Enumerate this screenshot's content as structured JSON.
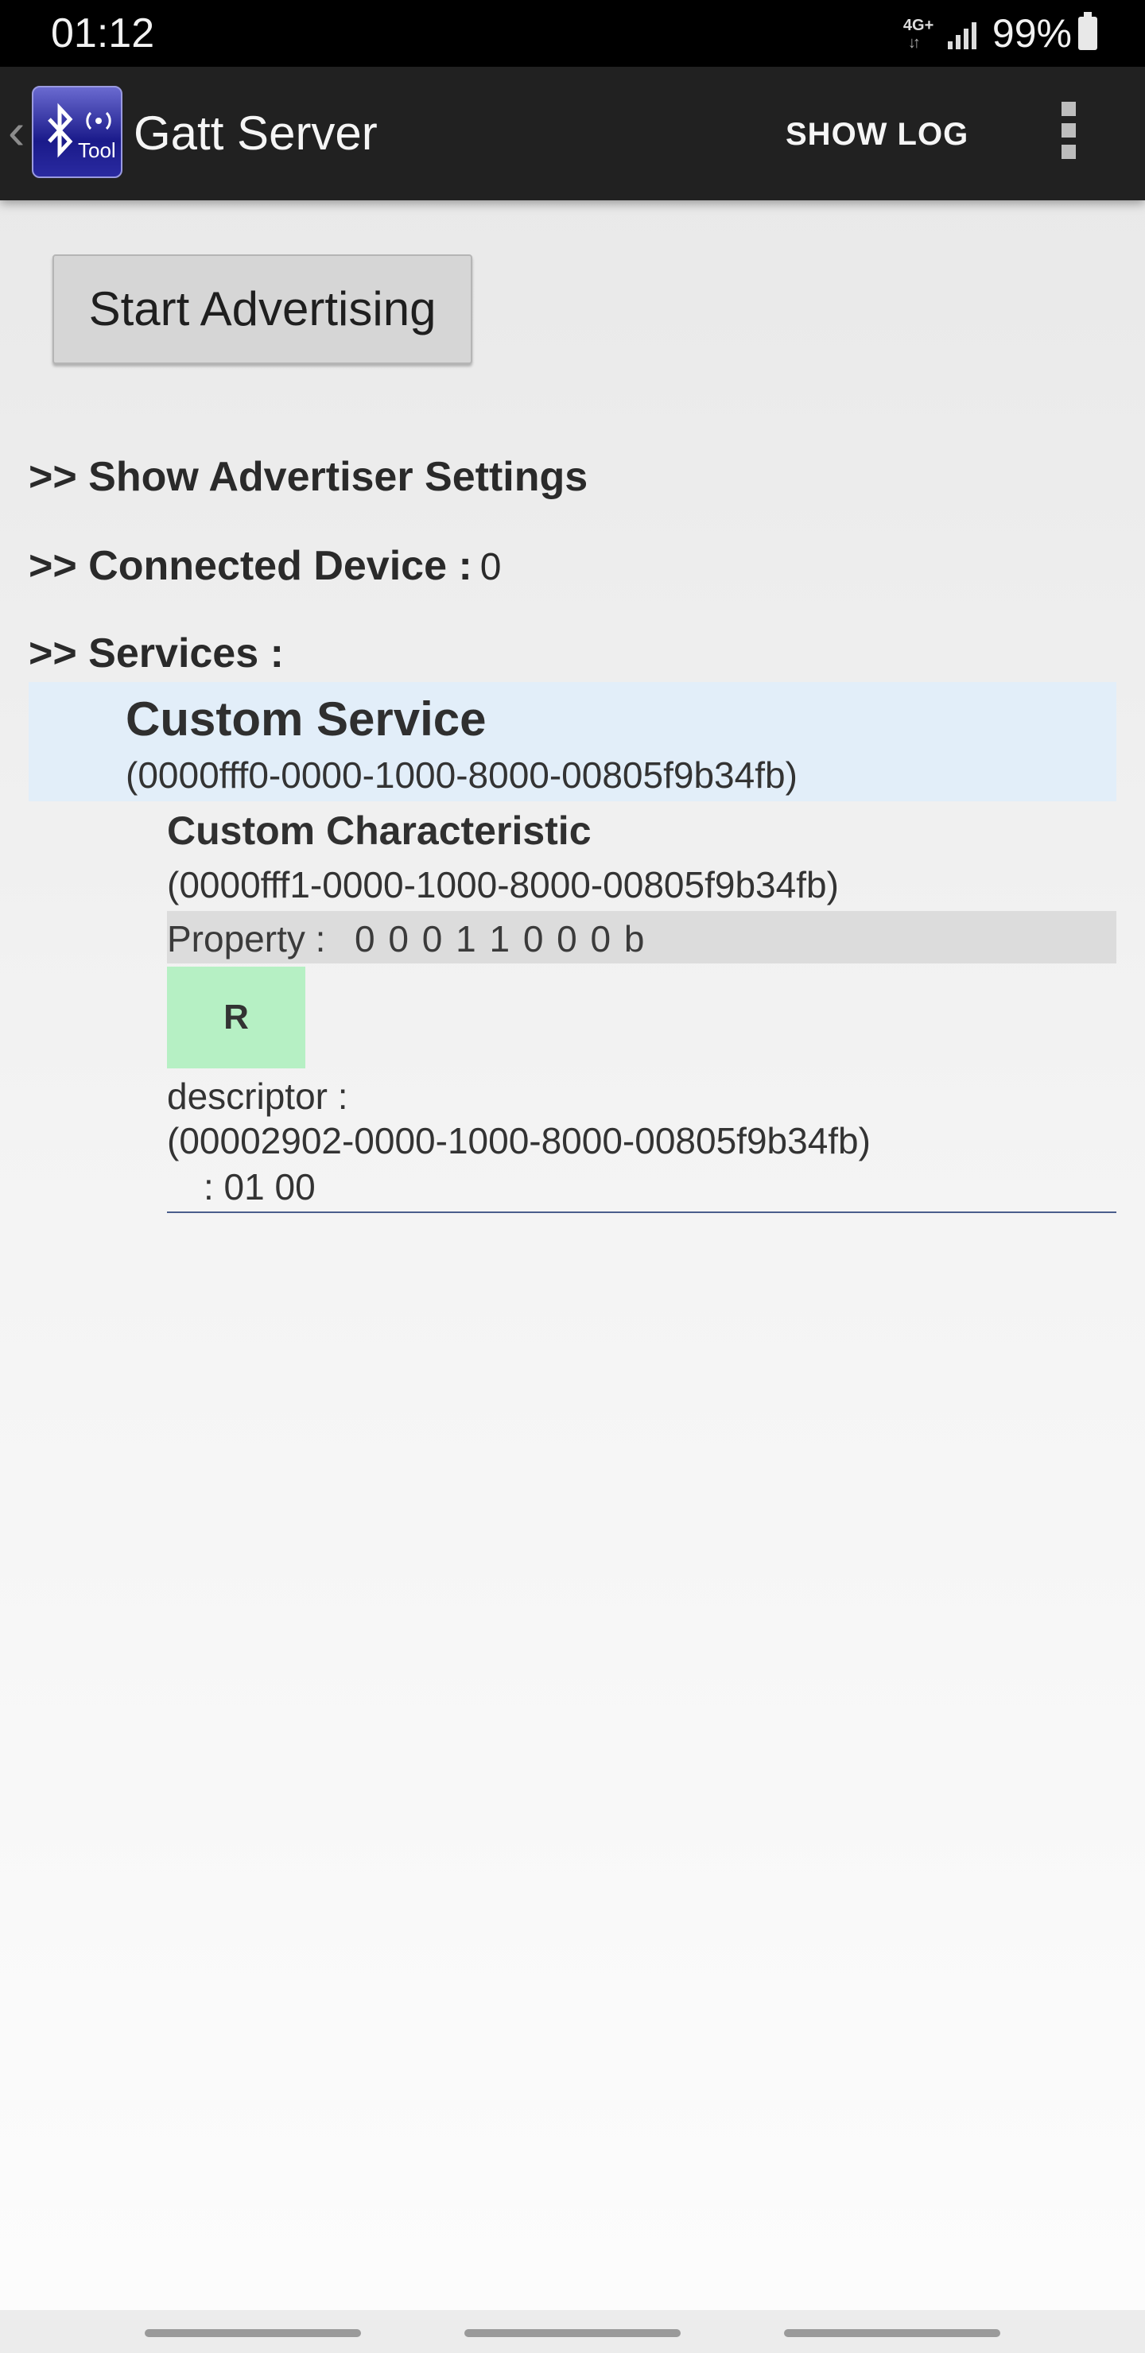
{
  "status_bar": {
    "time": "01:12",
    "network": "4G+",
    "battery": "99%"
  },
  "app_bar": {
    "title": "Gatt Server",
    "show_log": "SHOW LOG",
    "logo_text": "Tool"
  },
  "main": {
    "start_button": "Start Advertising",
    "advertiser_settings": ">> Show Advertiser Settings",
    "connected_label": ">> Connected Device :",
    "connected_count": "0",
    "services_label": ">> Services :"
  },
  "service": {
    "name": "Custom Service",
    "uuid": "(0000fff0-0000-1000-8000-00805f9b34fb)",
    "characteristic": {
      "name": "Custom Characteristic",
      "uuid": "(0000fff1-0000-1000-8000-00805f9b34fb)",
      "property_label": "Property :",
      "property_value": "0 0 0 1 1 0 0 0 b",
      "read_button": "R",
      "descriptor_label": "descriptor :",
      "descriptor_uuid": "(00002902-0000-1000-8000-00805f9b34fb)",
      "descriptor_value": ": 01 00"
    }
  },
  "colors": {
    "app_bar": "#212121",
    "service_highlight": "#e2eef9",
    "read_button": "#b6f0c4"
  }
}
